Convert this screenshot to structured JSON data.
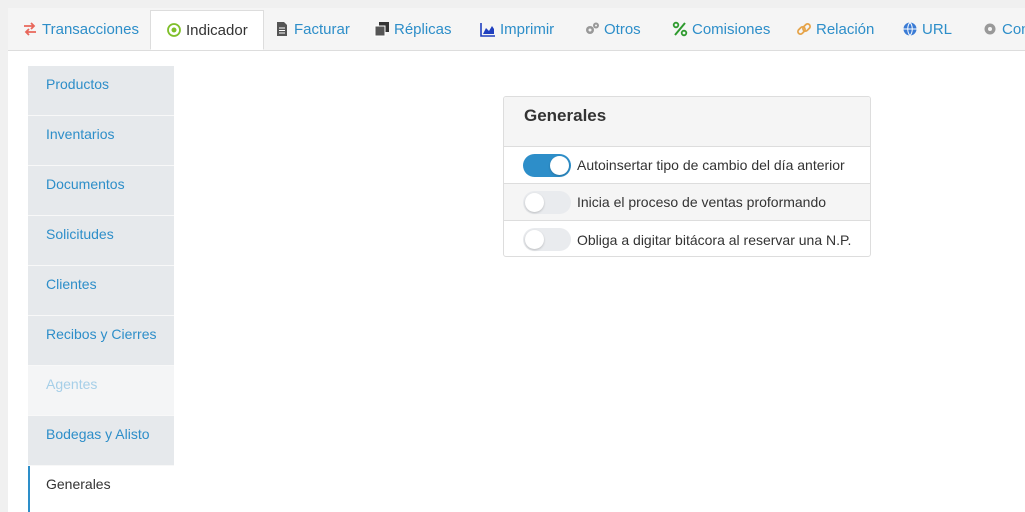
{
  "tabs": [
    {
      "label": "Transacciones",
      "icon": "transfer-arrows-icon"
    },
    {
      "label": "Indicador",
      "icon": "target-circle-icon",
      "active": true
    },
    {
      "label": "Facturar",
      "icon": "document-icon"
    },
    {
      "label": "Réplicas",
      "icon": "copy-stack-icon"
    },
    {
      "label": "Imprimir",
      "icon": "area-chart-icon"
    },
    {
      "label": "Otros",
      "icon": "gears-icon"
    },
    {
      "label": "Comisiones",
      "icon": "percent-icon"
    },
    {
      "label": "Relación",
      "icon": "link-icon"
    },
    {
      "label": "URL",
      "icon": "globe-icon"
    },
    {
      "label": "Con",
      "icon": "gear-icon"
    }
  ],
  "sidebar": {
    "items": [
      {
        "label": "Productos"
      },
      {
        "label": "Inventarios"
      },
      {
        "label": "Documentos"
      },
      {
        "label": "Solicitudes"
      },
      {
        "label": "Clientes"
      },
      {
        "label": "Recibos y Cierres"
      },
      {
        "label": "Agentes",
        "state": "disabled"
      },
      {
        "label": "Bodegas y Alisto"
      },
      {
        "label": "Generales",
        "state": "active"
      }
    ]
  },
  "panel": {
    "title": "Generales",
    "options": [
      {
        "label": "Autoinsertar tipo de cambio del día anterior",
        "enabled": true
      },
      {
        "label": "Inicia el proceso de ventas proformando",
        "enabled": false
      },
      {
        "label": "Obliga a digitar bitácora al reservar una N.P.",
        "enabled": false
      }
    ]
  },
  "colors": {
    "accent": "#2d8ec9",
    "toggle_off": "#e9ebee",
    "sidebar_bg": "#e6e9ec"
  }
}
